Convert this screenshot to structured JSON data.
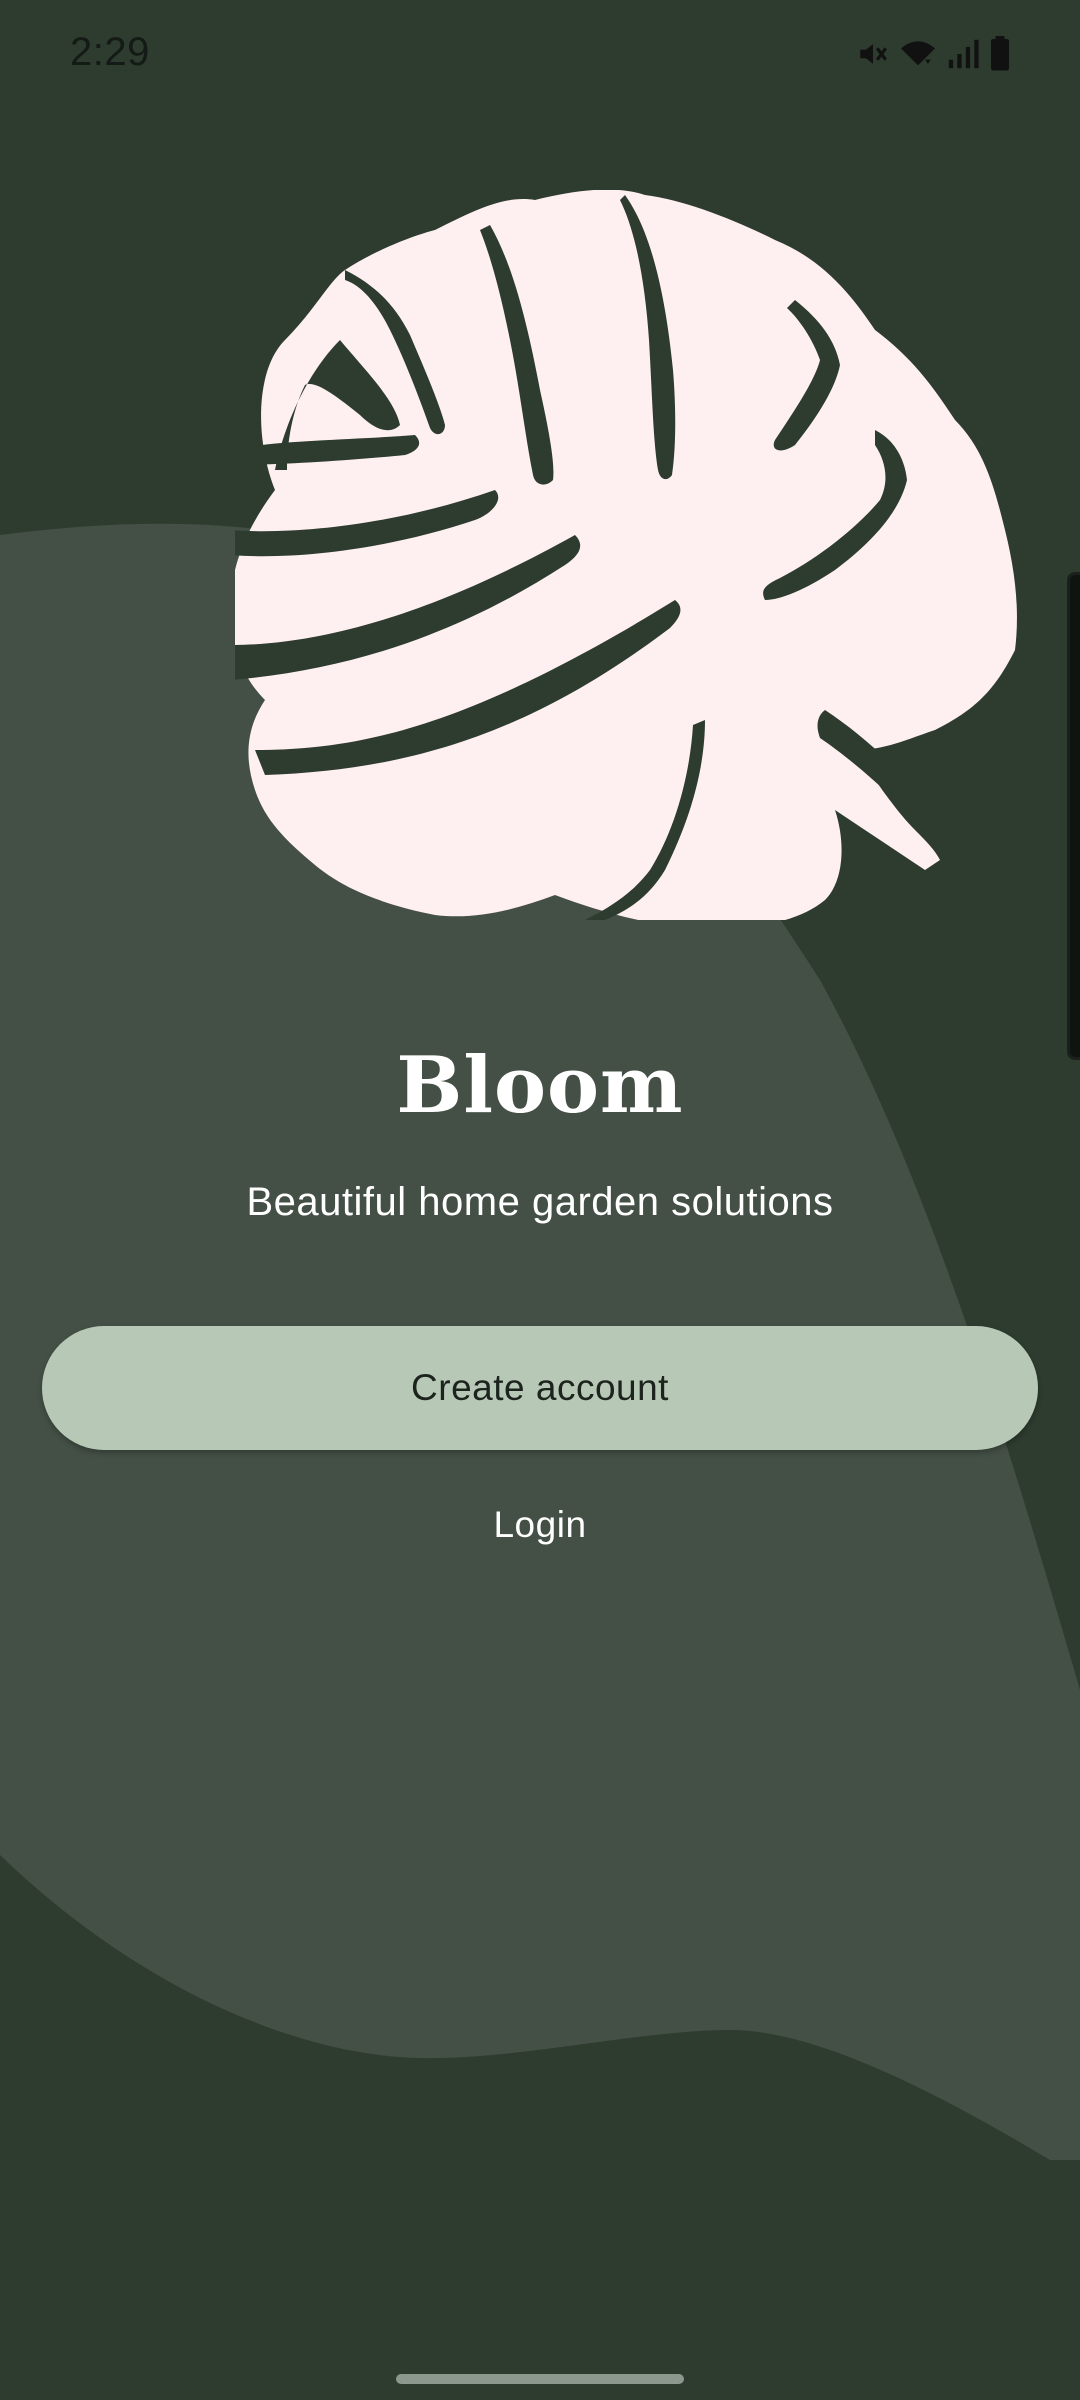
{
  "status_bar": {
    "time": "2:29",
    "icons": [
      "mute-icon",
      "wifi-icon",
      "signal-icon",
      "battery-icon"
    ]
  },
  "colors": {
    "background": "#2e3b2f",
    "wave": "#445046",
    "leaf": "#fef0f0",
    "button": "#b7c9b6",
    "text": "#ffffff"
  },
  "welcome": {
    "title": "Bloom",
    "subtitle": "Beautiful home garden solutions",
    "create_account_label": "Create account",
    "login_label": "Login"
  }
}
